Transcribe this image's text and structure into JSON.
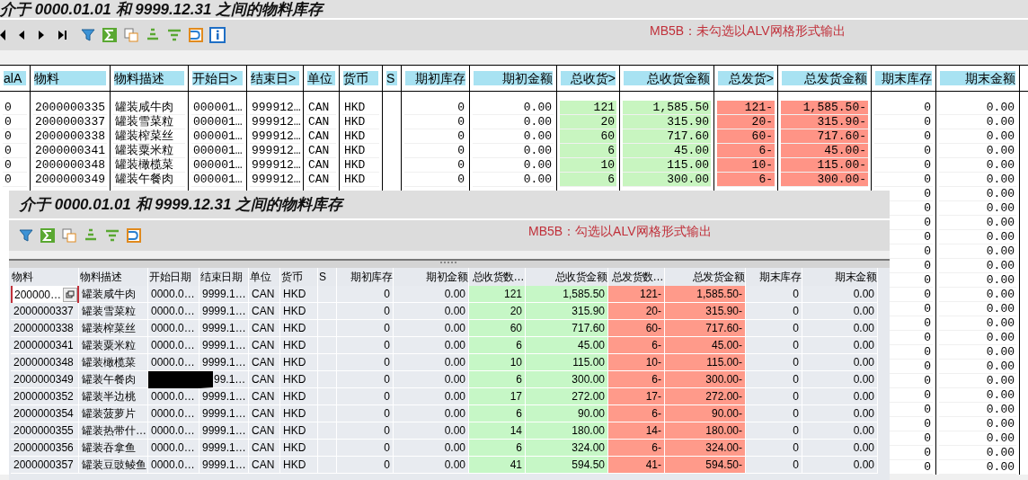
{
  "report": {
    "title": "介于 0000.01.01 和 9999.12.31 之间的物料库存",
    "note": "MB5B：未勾选以ALV网格形式输出",
    "columns": [
      {
        "label": "alA",
        "kind": "text"
      },
      {
        "label": "物料",
        "kind": "text"
      },
      {
        "label": "物料描述",
        "kind": "text"
      },
      {
        "label": "开始日>",
        "kind": "text"
      },
      {
        "label": "结束日>",
        "kind": "text"
      },
      {
        "label": "单位",
        "kind": "text"
      },
      {
        "label": "货币",
        "kind": "text"
      },
      {
        "label": "S",
        "kind": "text"
      },
      {
        "label": "期初库存",
        "kind": "number"
      },
      {
        "label": "期初金额",
        "kind": "number"
      },
      {
        "label": "总收货>",
        "kind": "receipt"
      },
      {
        "label": "总收货金额",
        "kind": "receipt"
      },
      {
        "label": "总发货>",
        "kind": "issue"
      },
      {
        "label": "总发货金额",
        "kind": "issue"
      },
      {
        "label": "期末库存",
        "kind": "number"
      },
      {
        "label": "期末金额",
        "kind": "number"
      }
    ],
    "rows": [
      {
        "c1": "0",
        "material": "2000000335",
        "description": "罐装咸牛肉",
        "start": "000001…",
        "end": "999912…",
        "unit": "CAN",
        "currency": "HKD",
        "open_stock": "0",
        "open_amount": "0.00",
        "receipts": "121",
        "receipt_amount": "1,585.50",
        "issues": "121-",
        "issue_amount": "1,585.50-",
        "close_stock": "0",
        "close_amount": "0.00"
      },
      {
        "c1": "0",
        "material": "2000000337",
        "description": "罐装雪菜粒",
        "start": "000001…",
        "end": "999912…",
        "unit": "CAN",
        "currency": "HKD",
        "open_stock": "0",
        "open_amount": "0.00",
        "receipts": "20",
        "receipt_amount": "315.90",
        "issues": "20-",
        "issue_amount": "315.90-",
        "close_stock": "0",
        "close_amount": "0.00"
      },
      {
        "c1": "0",
        "material": "2000000338",
        "description": "罐装榨菜丝",
        "start": "000001…",
        "end": "999912…",
        "unit": "CAN",
        "currency": "HKD",
        "open_stock": "0",
        "open_amount": "0.00",
        "receipts": "60",
        "receipt_amount": "717.60",
        "issues": "60-",
        "issue_amount": "717.60-",
        "close_stock": "0",
        "close_amount": "0.00"
      },
      {
        "c1": "0",
        "material": "2000000341",
        "description": "罐装粟米粒",
        "start": "000001…",
        "end": "999912…",
        "unit": "CAN",
        "currency": "HKD",
        "open_stock": "0",
        "open_amount": "0.00",
        "receipts": "6",
        "receipt_amount": "45.00",
        "issues": "6-",
        "issue_amount": "45.00-",
        "close_stock": "0",
        "close_amount": "0.00"
      },
      {
        "c1": "0",
        "material": "2000000348",
        "description": "罐装橄榄菜",
        "start": "000001…",
        "end": "999912…",
        "unit": "CAN",
        "currency": "HKD",
        "open_stock": "0",
        "open_amount": "0.00",
        "receipts": "10",
        "receipt_amount": "115.00",
        "issues": "10-",
        "issue_amount": "115.00-",
        "close_stock": "0",
        "close_amount": "0.00"
      },
      {
        "c1": "0",
        "material": "2000000349",
        "description": "罐装午餐肉",
        "start": "000001…",
        "end": "999912…",
        "unit": "CAN",
        "currency": "HKD",
        "open_stock": "0",
        "open_amount": "0.00",
        "receipts": "6",
        "receipt_amount": "300.00",
        "issues": "6-",
        "issue_amount": "300.00-",
        "close_stock": "0",
        "close_amount": "0.00"
      },
      {
        "close_stock": "0",
        "close_amount": "0.00"
      },
      {
        "close_stock": "0",
        "close_amount": "0.00"
      },
      {
        "close_stock": "0",
        "close_amount": "0.00"
      },
      {
        "close_stock": "0",
        "close_amount": "0.00"
      },
      {
        "close_stock": "0",
        "close_amount": "0.00"
      },
      {
        "close_stock": "0",
        "close_amount": "0.00"
      },
      {
        "close_stock": "0",
        "close_amount": "0.00"
      },
      {
        "close_stock": "0",
        "close_amount": "0.00"
      },
      {
        "close_stock": "0",
        "close_amount": "0.00"
      },
      {
        "close_stock": "0",
        "close_amount": "0.00"
      },
      {
        "close_stock": "0",
        "close_amount": "0.00"
      },
      {
        "close_stock": "0",
        "close_amount": "0.00"
      },
      {
        "close_stock": "0",
        "close_amount": "0.00"
      },
      {
        "close_stock": "0",
        "close_amount": "0.00"
      },
      {
        "close_stock": "0",
        "close_amount": "0.00"
      },
      {
        "close_stock": "0",
        "close_amount": "0.00"
      },
      {
        "close_stock": "0",
        "close_amount": "0.00"
      },
      {
        "close_stock": "0",
        "close_amount": "0.00"
      },
      {
        "close_stock": "0",
        "close_amount": "0.00"
      },
      {
        "close_stock": "0",
        "close_amount": "0.00"
      }
    ]
  },
  "alv": {
    "title": "介于 0000.01.01 和 9999.12.31 之间的物料库存",
    "note": "MB5B：勾选以ALV网格形式输出",
    "columns": [
      {
        "label": "物料",
        "kind": "text"
      },
      {
        "label": "物料描述",
        "kind": "text"
      },
      {
        "label": "开始日期",
        "kind": "text"
      },
      {
        "label": "结束日期",
        "kind": "text"
      },
      {
        "label": "单位",
        "kind": "text"
      },
      {
        "label": "货币",
        "kind": "text"
      },
      {
        "label": "S",
        "kind": "text"
      },
      {
        "label": "期初库存",
        "kind": "number"
      },
      {
        "label": "期初金额",
        "kind": "number"
      },
      {
        "label": "总收货数…",
        "kind": "receipt"
      },
      {
        "label": "总收货金额",
        "kind": "receipt"
      },
      {
        "label": "总发货数…",
        "kind": "issue"
      },
      {
        "label": "总发货金额",
        "kind": "issue"
      },
      {
        "label": "期末库存",
        "kind": "number"
      },
      {
        "label": "期末金额",
        "kind": "number"
      }
    ],
    "rows": [
      {
        "focused": true,
        "redacted": false,
        "material": "200000…",
        "description": "罐装咸牛肉",
        "start": "0000.0…",
        "end": "9999.1…",
        "unit": "CAN",
        "currency": "HKD",
        "open_stock": "0",
        "open_amount": "0.00",
        "receipts": "121",
        "receipt_amount": "1,585.50",
        "issues": "121-",
        "issue_amount": "1,585.50-",
        "close_stock": "0",
        "close_amount": "0.00"
      },
      {
        "focused": false,
        "redacted": false,
        "material": "2000000337",
        "description": "罐装雪菜粒",
        "start": "0000.0…",
        "end": "9999.1…",
        "unit": "CAN",
        "currency": "HKD",
        "open_stock": "0",
        "open_amount": "0.00",
        "receipts": "20",
        "receipt_amount": "315.90",
        "issues": "20-",
        "issue_amount": "315.90-",
        "close_stock": "0",
        "close_amount": "0.00"
      },
      {
        "focused": false,
        "redacted": false,
        "material": "2000000338",
        "description": "罐装榨菜丝",
        "start": "0000.0…",
        "end": "9999.1…",
        "unit": "CAN",
        "currency": "HKD",
        "open_stock": "0",
        "open_amount": "0.00",
        "receipts": "60",
        "receipt_amount": "717.60",
        "issues": "60-",
        "issue_amount": "717.60-",
        "close_stock": "0",
        "close_amount": "0.00"
      },
      {
        "focused": false,
        "redacted": false,
        "material": "2000000341",
        "description": "罐装粟米粒",
        "start": "0000.0…",
        "end": "9999.1…",
        "unit": "CAN",
        "currency": "HKD",
        "open_stock": "0",
        "open_amount": "0.00",
        "receipts": "6",
        "receipt_amount": "45.00",
        "issues": "6-",
        "issue_amount": "45.00-",
        "close_stock": "0",
        "close_amount": "0.00"
      },
      {
        "focused": false,
        "redacted": false,
        "material": "2000000348",
        "description": "罐装橄榄菜",
        "start": "0000.0…",
        "end": "9999.1…",
        "unit": "CAN",
        "currency": "HKD",
        "open_stock": "0",
        "open_amount": "0.00",
        "receipts": "10",
        "receipt_amount": "115.00",
        "issues": "10-",
        "issue_amount": "115.00-",
        "close_stock": "0",
        "close_amount": "0.00"
      },
      {
        "focused": false,
        "redacted": true,
        "material": "2000000349",
        "description": "罐装午餐肉",
        "end": "99.1…",
        "unit": "CAN",
        "currency": "HKD",
        "open_stock": "0",
        "open_amount": "0.00",
        "receipts": "6",
        "receipt_amount": "300.00",
        "issues": "6-",
        "issue_amount": "300.00-",
        "close_stock": "0",
        "close_amount": "0.00"
      },
      {
        "focused": false,
        "redacted": false,
        "material": "2000000352",
        "description": "罐装半边桃",
        "start": "0000.0…",
        "end": "9999.1…",
        "unit": "CAN",
        "currency": "HKD",
        "open_stock": "0",
        "open_amount": "0.00",
        "receipts": "17",
        "receipt_amount": "272.00",
        "issues": "17-",
        "issue_amount": "272.00-",
        "close_stock": "0",
        "close_amount": "0.00"
      },
      {
        "focused": false,
        "redacted": false,
        "material": "2000000354",
        "description": "罐装菠萝片",
        "start": "0000.0…",
        "end": "9999.1…",
        "unit": "CAN",
        "currency": "HKD",
        "open_stock": "0",
        "open_amount": "0.00",
        "receipts": "6",
        "receipt_amount": "90.00",
        "issues": "6-",
        "issue_amount": "90.00-",
        "close_stock": "0",
        "close_amount": "0.00"
      },
      {
        "focused": false,
        "redacted": false,
        "material": "2000000355",
        "description": "罐装热带什…",
        "start": "0000.0…",
        "end": "9999.1…",
        "unit": "CAN",
        "currency": "HKD",
        "open_stock": "0",
        "open_amount": "0.00",
        "receipts": "14",
        "receipt_amount": "180.00",
        "issues": "14-",
        "issue_amount": "180.00-",
        "close_stock": "0",
        "close_amount": "0.00"
      },
      {
        "focused": false,
        "redacted": false,
        "material": "2000000356",
        "description": "罐装吞拿鱼",
        "start": "0000.0…",
        "end": "9999.1…",
        "unit": "CAN",
        "currency": "HKD",
        "open_stock": "0",
        "open_amount": "0.00",
        "receipts": "6",
        "receipt_amount": "324.00",
        "issues": "6-",
        "issue_amount": "324.00-",
        "close_stock": "0",
        "close_amount": "0.00"
      },
      {
        "focused": false,
        "redacted": false,
        "material": "2000000357",
        "description": "罐装豆豉鲮鱼",
        "start": "0000.0…",
        "end": "9999.1…",
        "unit": "CAN",
        "currency": "HKD",
        "open_stock": "0",
        "open_amount": "0.00",
        "receipts": "41",
        "receipt_amount": "594.50",
        "issues": "41-",
        "issue_amount": "594.50-",
        "close_stock": "0",
        "close_amount": "0.00"
      }
    ]
  }
}
